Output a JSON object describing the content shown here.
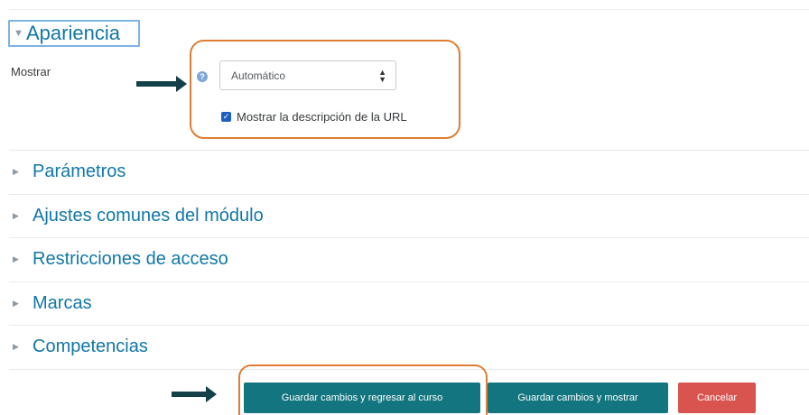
{
  "appearance": {
    "title": "Apariencia",
    "mostrar_label": "Mostrar",
    "help_glyph": "?",
    "select_value": "Automático",
    "checkbox_label": "Mostrar la descripción de la URL",
    "checkbox_checked": true
  },
  "sections": [
    {
      "label": "Parámetros"
    },
    {
      "label": "Ajustes comunes del módulo"
    },
    {
      "label": "Restricciones de acceso"
    },
    {
      "label": "Marcas"
    },
    {
      "label": "Competencias"
    }
  ],
  "buttons": {
    "save_return": "Guardar cambios y regresar al curso",
    "save_display": "Guardar cambios y mostrar",
    "cancel": "Cancelar"
  },
  "colors": {
    "link": "#1177a8",
    "primary_button": "#13757f",
    "danger_button": "#d9534f",
    "annotation_outline": "#e07d33",
    "annotation_arrow": "#14404a"
  }
}
